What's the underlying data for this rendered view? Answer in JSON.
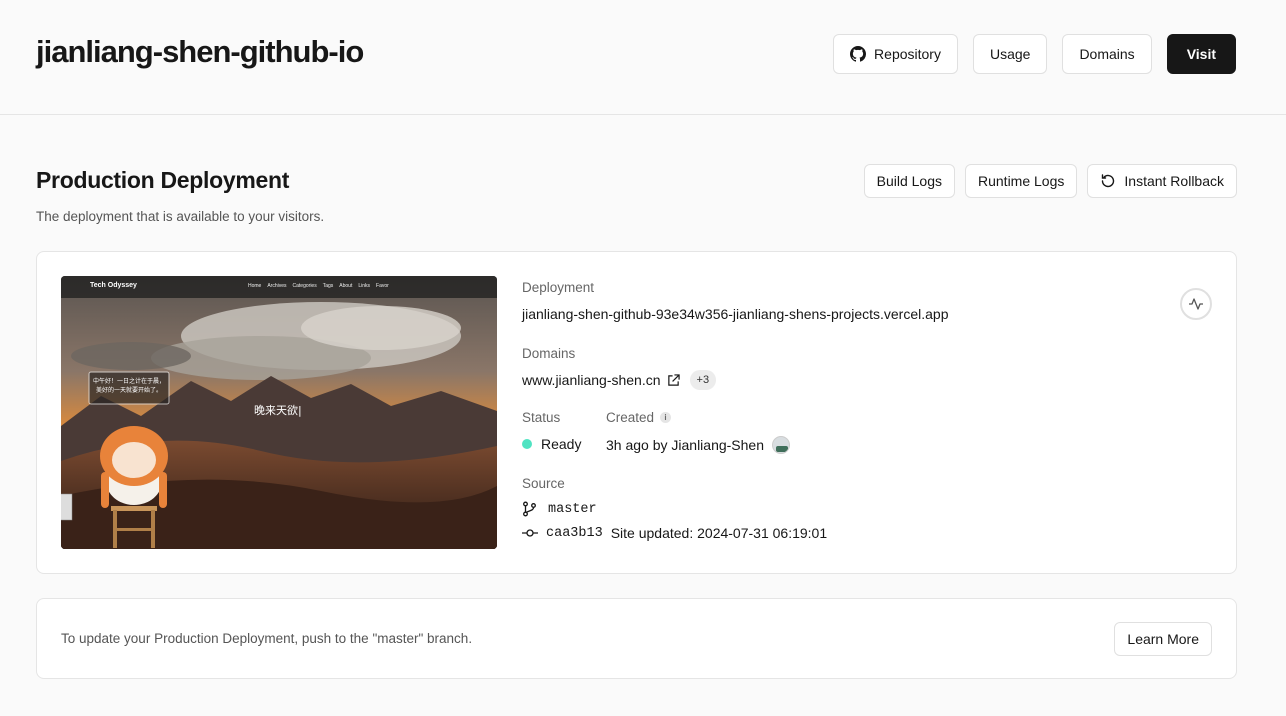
{
  "header": {
    "title": "jianliang-shen-github-io",
    "repository_label": "Repository",
    "usage_label": "Usage",
    "domains_label": "Domains",
    "visit_label": "Visit"
  },
  "section": {
    "title": "Production Deployment",
    "subtitle": "The deployment that is available to your visitors.",
    "build_logs_label": "Build Logs",
    "runtime_logs_label": "Runtime Logs",
    "rollback_label": "Instant Rollback"
  },
  "preview": {
    "site_name": "Tech Odyssey",
    "nav": [
      "Home",
      "Archives",
      "Categories",
      "Tags",
      "About",
      "Links",
      "Favor"
    ],
    "bubble_line1": "中午好！一日之计在于晨，",
    "bubble_line2": "美好的一天就要开始了。",
    "typing_text": "晚来天欲|"
  },
  "deployment": {
    "label": "Deployment",
    "url": "jianliang-shen-github-93e34w356-jianliang-shens-projects.vercel.app",
    "domains_label": "Domains",
    "domain": "www.jianliang-shen.cn",
    "extra_domains": "+3",
    "status_label": "Status",
    "status": "Ready",
    "status_color": "#50e3c2",
    "created_label": "Created",
    "created": "3h ago by Jianliang-Shen",
    "source_label": "Source",
    "branch": "master",
    "commit": "caa3b13",
    "commit_message": "Site updated: 2024-07-31 06:19:01"
  },
  "notice": {
    "text": "To update your Production Deployment, push to the \"master\" branch.",
    "learn_more_label": "Learn More"
  }
}
